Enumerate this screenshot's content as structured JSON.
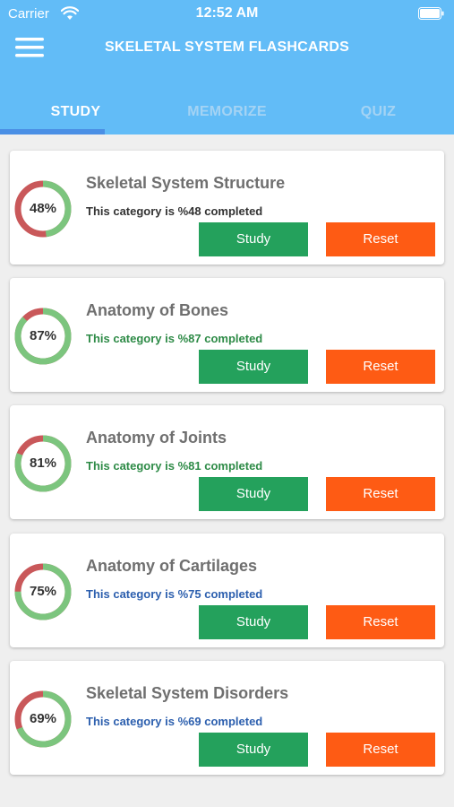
{
  "status_bar": {
    "carrier": "Carrier",
    "time": "12:52 AM"
  },
  "header": {
    "title": "SKELETAL SYSTEM FLASHCARDS"
  },
  "tabs": [
    {
      "label": "STUDY",
      "active": true
    },
    {
      "label": "MEMORIZE",
      "active": false
    },
    {
      "label": "QUIZ",
      "active": false
    }
  ],
  "buttons": {
    "study_label": "Study",
    "reset_label": "Reset"
  },
  "colors": {
    "header": "#62bcf7",
    "ring_done": "#7cc57e",
    "ring_remaining": "#c9585a",
    "study_button": "#24a15c",
    "reset_button": "#fe5b14"
  },
  "categories": [
    {
      "title": "Skeletal System Structure",
      "percent": 48,
      "percent_label": "48%",
      "status": "This category is %48 completed",
      "status_color": "#333333"
    },
    {
      "title": "Anatomy of Bones",
      "percent": 87,
      "percent_label": "87%",
      "status": "This category is %87 completed",
      "status_color": "#2e8b47"
    },
    {
      "title": "Anatomy of Joints",
      "percent": 81,
      "percent_label": "81%",
      "status": "This category is %81 completed",
      "status_color": "#2e8b47"
    },
    {
      "title": "Anatomy of Cartilages",
      "percent": 75,
      "percent_label": "75%",
      "status": "This category is %75 completed",
      "status_color": "#2c5fae"
    },
    {
      "title": "Skeletal System Disorders",
      "percent": 69,
      "percent_label": "69%",
      "status": "This category is %69 completed",
      "status_color": "#2c5fae"
    }
  ]
}
